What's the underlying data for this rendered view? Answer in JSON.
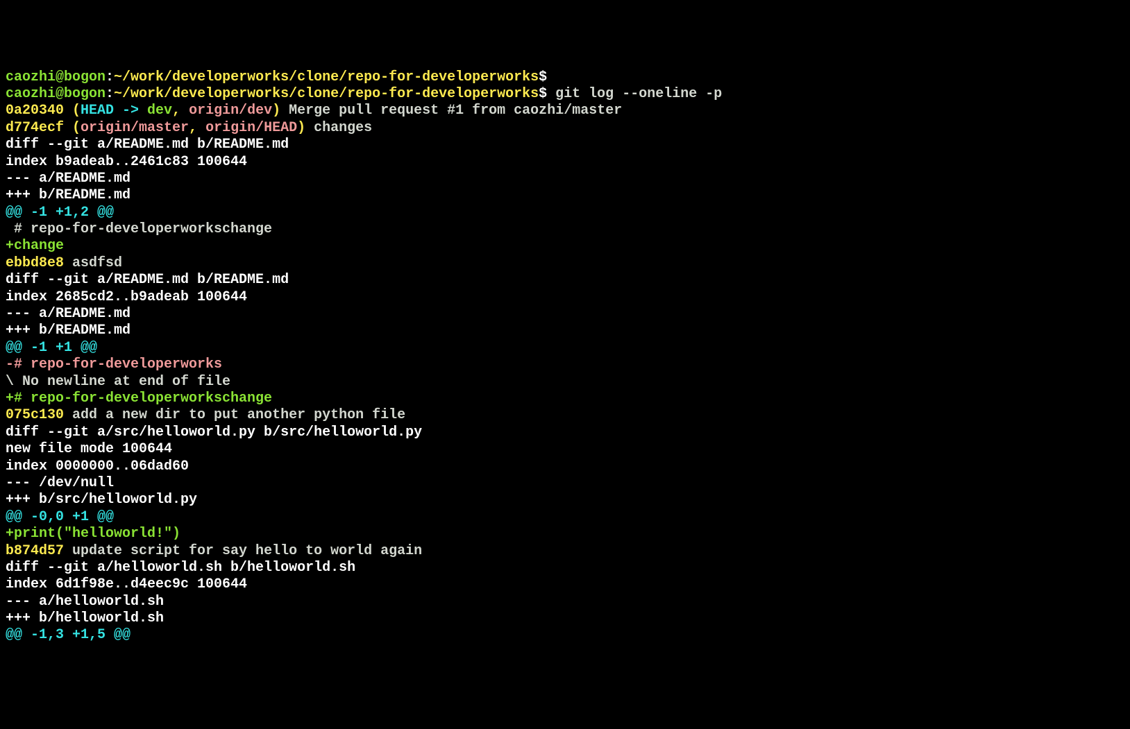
{
  "prompt1": {
    "user_host": "caozhi@bogon",
    "sep1": ":",
    "path": "~/work/developerworks/clone/repo-for-developerworks",
    "sep2": "$"
  },
  "prompt2": {
    "user_host": "caozhi@bogon",
    "sep1": ":",
    "path": "~/work/developerworks/clone/repo-for-developerworks",
    "sep2": "$",
    "command": " git log --oneline -p"
  },
  "commit1": {
    "hash": "0a20340",
    "open_paren": " (",
    "head": "HEAD -> ",
    "branch": "dev",
    "comma": ", ",
    "remote": "origin/dev",
    "close_paren": ")",
    "message": " Merge pull request #1 from caozhi/master"
  },
  "commit2": {
    "hash": "d774ecf",
    "open_paren": " (",
    "remote1": "origin/master",
    "comma": ", ",
    "remote2": "origin/HEAD",
    "close_paren": ")",
    "message": " changes"
  },
  "diff1": {
    "header": "diff --git a/README.md b/README.md",
    "index": "index b9adeab..2461c83 100644",
    "removed_file": "--- a/README.md",
    "added_file": "+++ b/README.md",
    "hunk": "@@ -1 +1,2 @@",
    "context": " # repo-for-developerworkschange",
    "added1": "+change"
  },
  "commit3": {
    "hash": "ebbd8e8",
    "message": " asdfsd"
  },
  "diff2": {
    "header": "diff --git a/README.md b/README.md",
    "index": "index 2685cd2..b9adeab 100644",
    "removed_file": "--- a/README.md",
    "added_file": "+++ b/README.md",
    "hunk": "@@ -1 +1 @@",
    "removed1": "-# repo-for-developerworks",
    "no_newline": "\\ No newline at end of file",
    "added1": "+# repo-for-developerworkschange"
  },
  "commit4": {
    "hash": "075c130",
    "message": " add a new dir to put another python file"
  },
  "diff3": {
    "header": "diff --git a/src/helloworld.py b/src/helloworld.py",
    "new_file": "new file mode 100644",
    "index": "index 0000000..06dad60",
    "removed_file": "--- /dev/null",
    "added_file": "+++ b/src/helloworld.py",
    "hunk": "@@ -0,0 +1 @@",
    "added1": "+print(\"helloworld!\")"
  },
  "commit5": {
    "hash": "b874d57",
    "message": " update script for say hello to world again"
  },
  "diff4": {
    "header": "diff --git a/helloworld.sh b/helloworld.sh",
    "index": "index 6d1f98e..d4eec9c 100644",
    "removed_file": "--- a/helloworld.sh",
    "added_file": "+++ b/helloworld.sh",
    "hunk": "@@ -1,3 +1,5 @@"
  }
}
